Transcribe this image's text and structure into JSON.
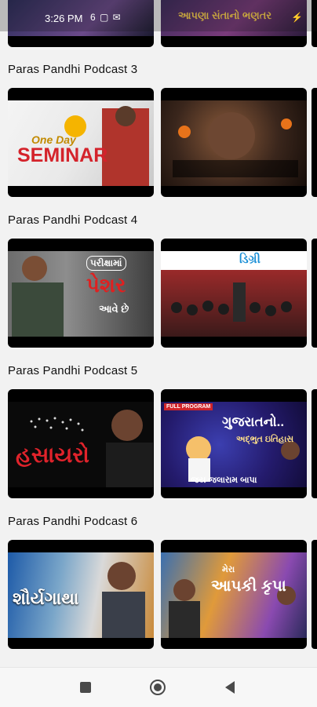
{
  "status_bar": {
    "time": "3:26 PM",
    "icons_left": "6 ▢ ✉",
    "icons_right": "⚡"
  },
  "top_row": {
    "thumb_left_text": "",
    "thumb_right_text": "આપણા સંતાનો ભણતર"
  },
  "sections": [
    {
      "title": "Paras Pandhi Podcast 3",
      "thumbs": [
        {
          "text_main": "SEMINAR",
          "text_sub": "One Day"
        },
        {
          "text_main": "",
          "text_sub": ""
        }
      ]
    },
    {
      "title": "Paras Pandhi Podcast 4",
      "thumbs": [
        {
          "text_main": "પેશર",
          "text_sub": "પરીક્ષામાં",
          "text_extra": "આવે છે"
        },
        {
          "text_main": "ડિગ્રી",
          "text_sub": ""
        }
      ]
    },
    {
      "title": "Paras Pandhi Podcast 5",
      "thumbs": [
        {
          "text_main": "હસાયરો",
          "text_sub": ""
        },
        {
          "text_main": "ગુજરાતનો..",
          "text_sub": "અદ્ભુત ઇતિહાસ",
          "badge": "FULL PROGRAM",
          "footer": "જય જલારામ બાપા"
        }
      ]
    },
    {
      "title": "Paras Pandhi Podcast 6",
      "thumbs": [
        {
          "text_main": "શૌર્યગાથા",
          "text_sub": ""
        },
        {
          "text_main": "આપકી કૃપા",
          "text_sub": "મેરા"
        }
      ]
    }
  ],
  "colors": {
    "background": "#f2f2f2",
    "thumb_frame": "#000000",
    "title_text": "#111111"
  }
}
